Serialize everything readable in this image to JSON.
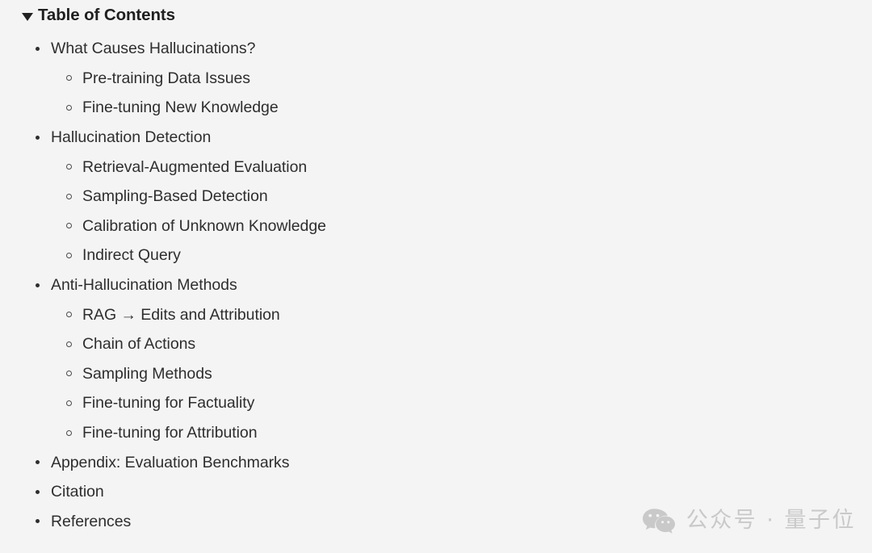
{
  "colors": {
    "background": "#f4f4f4",
    "text": "#2e2e2e",
    "heading": "#1f1f1f",
    "bullet": "#2e2e2e",
    "watermark": "#c9c9c9"
  },
  "header": {
    "title": "Table of Contents",
    "disclosure_state": "expanded",
    "disclosure_glyph": "▼"
  },
  "toc": {
    "items": [
      {
        "label": "What Causes Hallucinations?",
        "children": [
          {
            "label": "Pre-training Data Issues"
          },
          {
            "label": "Fine-tuning New Knowledge"
          }
        ]
      },
      {
        "label": "Hallucination Detection",
        "children": [
          {
            "label": "Retrieval-Augmented Evaluation"
          },
          {
            "label": "Sampling-Based Detection"
          },
          {
            "label": "Calibration of Unknown Knowledge"
          },
          {
            "label": "Indirect Query"
          }
        ]
      },
      {
        "label": "Anti-Hallucination Methods",
        "children": [
          {
            "label": "RAG → Edits and Attribution"
          },
          {
            "label": "Chain of Actions"
          },
          {
            "label": "Sampling Methods"
          },
          {
            "label": "Fine-tuning for Factuality"
          },
          {
            "label": "Fine-tuning for Attribution"
          }
        ]
      },
      {
        "label": "Appendix: Evaluation Benchmarks",
        "children": []
      },
      {
        "label": "Citation",
        "children": []
      },
      {
        "label": "References",
        "children": []
      }
    ]
  },
  "watermark": {
    "icon": "wechat-icon",
    "text": "公众号 · 量子位"
  }
}
